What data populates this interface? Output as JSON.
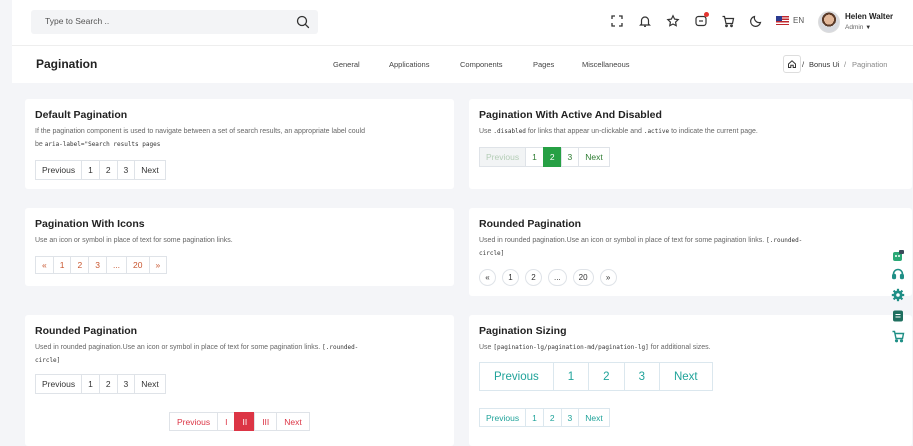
{
  "header": {
    "search_placeholder": "Type to Search ..",
    "language": "EN",
    "user": {
      "name": "Helen Walter",
      "role": "Admin"
    }
  },
  "subheader": {
    "title": "Pagination",
    "nav": [
      "General",
      "Applications",
      "Components",
      "Pages",
      "Miscellaneous"
    ],
    "breadcrumb": {
      "sep1": "/",
      "parent": "Bonus Ui",
      "sep2": "/",
      "current": "Pagination"
    }
  },
  "cards": {
    "default": {
      "title": "Default Pagination",
      "desc1": "If the pagination component is used to navigate between a set of search results, an appropriate label could",
      "desc2_prefix": "be ",
      "desc2_code": "aria-label=\"Search results pages",
      "items": [
        "Previous",
        "1",
        "2",
        "3",
        "Next"
      ]
    },
    "active_disabled": {
      "title": "Pagination With Active And Disabled",
      "desc_a": "Use ",
      "code_a": ".disabled",
      "desc_b": " for links that appear un-clickable and ",
      "code_b": ".active",
      "desc_c": " to indicate the current page.",
      "items": [
        "Previous",
        "1",
        "2",
        "3",
        "Next"
      ]
    },
    "icons": {
      "title": "Pagination With Icons",
      "desc": "Use an icon or symbol in place of text for some pagination links.",
      "items": [
        "«",
        "1",
        "2",
        "3",
        "...",
        "20",
        "»"
      ]
    },
    "rounded_right": {
      "title": "Rounded Pagination",
      "desc1_text": "Used in rounded pagination.Use an icon or symbol in place of text for some pagination links. ",
      "desc1_code": "[.rounded-",
      "desc2_code": "circle]",
      "items": [
        "«",
        "1",
        "2",
        "...",
        "20",
        "»"
      ]
    },
    "rounded_left": {
      "title": "Rounded Pagination",
      "desc1_text": "Used in rounded pagination.Use an icon or symbol in place of text for some pagination links. ",
      "desc1_code": "[.rounded-",
      "desc2_code": "circle]",
      "items": [
        "Previous",
        "1",
        "2",
        "3",
        "Next"
      ],
      "items_red": [
        "Previous",
        "I",
        "II",
        "III",
        "Next"
      ]
    },
    "sizing": {
      "title": "Pagination Sizing",
      "desc_a": "Use ",
      "code": "[pagination-lg/pagination-md/pagination-lg]",
      "desc_b": " for additional sizes.",
      "items_lg": [
        "Previous",
        "1",
        "2",
        "3",
        "Next"
      ],
      "items_sm": [
        "Previous",
        "1",
        "2",
        "3",
        "Next"
      ]
    }
  },
  "colors": {
    "success": "#26a044",
    "danger": "#dc3545",
    "teal": "#20a39a",
    "orange": "#c8552e"
  },
  "icons": {
    "header": [
      "fullscreen-icon",
      "bell-icon",
      "star-icon",
      "chat-icon",
      "cart-icon",
      "moon-icon",
      "us-flag-icon"
    ],
    "side": [
      "chat-bot-icon",
      "headset-icon",
      "gear-icon",
      "note-icon",
      "cart-icon"
    ]
  }
}
